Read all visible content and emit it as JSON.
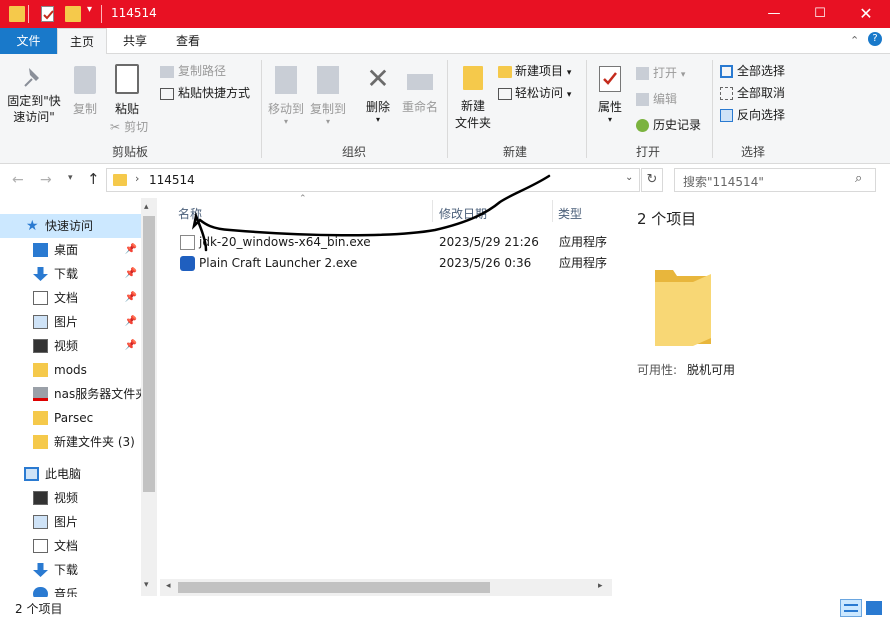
{
  "window": {
    "title": "114514",
    "accent": "#e81123"
  },
  "ribbon_tabs": [
    {
      "label": "文件"
    },
    {
      "label": "主页"
    },
    {
      "label": "共享"
    },
    {
      "label": "查看"
    }
  ],
  "ribbon": {
    "clipboard": {
      "pin_label": "固定到\"快速访问\"",
      "copy_label": "复制",
      "paste_label": "粘贴",
      "copy_path": "复制路径",
      "paste_shortcut": "粘贴快捷方式",
      "cut": "剪切",
      "group": "剪贴板"
    },
    "organize": {
      "move_to": "移动到",
      "copy_to": "复制到",
      "delete": "删除",
      "rename": "重命名",
      "group": "组织"
    },
    "new": {
      "new_folder": "新建\n文件夹",
      "new_item": "新建项目",
      "easy_access": "轻松访问",
      "group": "新建"
    },
    "open": {
      "properties": "属性",
      "open": "打开",
      "edit": "编辑",
      "history": "历史记录",
      "group": "打开"
    },
    "select": {
      "select_all": "全部选择",
      "select_none": "全部取消",
      "invert": "反向选择",
      "group": "选择"
    }
  },
  "address": {
    "path": "114514",
    "search_placeholder": "搜索\"114514\""
  },
  "nav": {
    "quick_access": "快速访问",
    "items": [
      {
        "label": "桌面",
        "icon": "desktop-icon",
        "pinned": true
      },
      {
        "label": "下载",
        "icon": "download-icon",
        "pinned": true
      },
      {
        "label": "文档",
        "icon": "document-icon",
        "pinned": true
      },
      {
        "label": "图片",
        "icon": "picture-icon",
        "pinned": true
      },
      {
        "label": "视频",
        "icon": "video-icon",
        "pinned": true
      },
      {
        "label": "mods",
        "icon": "folder-icon",
        "pinned": false
      },
      {
        "label": "nas服务器文件夹",
        "icon": "network-drive-icon",
        "pinned": false
      },
      {
        "label": "Parsec",
        "icon": "folder-icon",
        "pinned": false
      },
      {
        "label": "新建文件夹 (3)",
        "icon": "folder-icon",
        "pinned": false
      }
    ],
    "this_pc": "此电脑",
    "pc_items": [
      {
        "label": "视频",
        "icon": "video-icon"
      },
      {
        "label": "图片",
        "icon": "picture-icon"
      },
      {
        "label": "文档",
        "icon": "document-icon"
      },
      {
        "label": "下载",
        "icon": "download-icon"
      },
      {
        "label": "音乐",
        "icon": "music-icon"
      }
    ]
  },
  "files": {
    "columns": {
      "name": "名称",
      "date": "修改日期",
      "type": "类型"
    },
    "rows": [
      {
        "name": "jdk-20_windows-x64_bin.exe",
        "date": "2023/5/29 21:26",
        "type": "应用程序",
        "icon": "java-installer-icon"
      },
      {
        "name": "Plain Craft Launcher 2.exe",
        "date": "2023/5/26 0:36",
        "type": "应用程序",
        "icon": "pcl-launcher-icon"
      }
    ]
  },
  "preview": {
    "count": "2 个项目",
    "availability_label": "可用性:",
    "availability_value": "脱机可用"
  },
  "status": {
    "count": "2 个项目"
  }
}
